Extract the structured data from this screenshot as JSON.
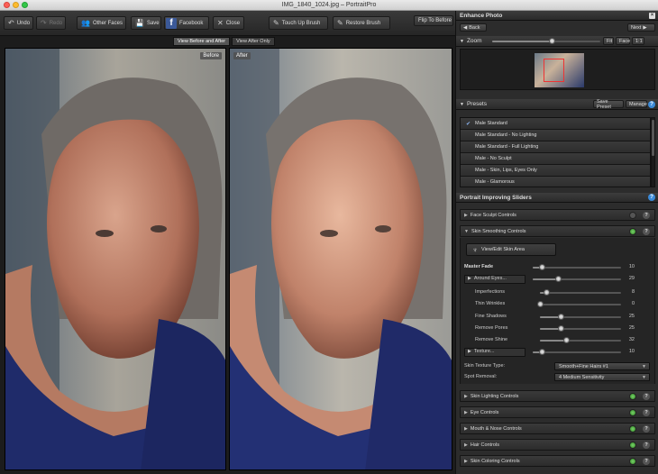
{
  "window": {
    "title": "IMG_1840_1024.jpg – PortraitPro"
  },
  "toolbar": {
    "undo": "Undo",
    "redo": "Redo",
    "other_faces": "Other Faces",
    "save": "Save",
    "facebook": "Facebook",
    "close": "Close",
    "touch_up_brush": "Touch Up Brush",
    "restore_brush": "Restore Brush",
    "flip_to_before": "Flip To Before"
  },
  "view_tabs": {
    "before_after": "View Before and After",
    "after_only": "View After Only"
  },
  "photos": {
    "before_label": "Before",
    "after_label": "After"
  },
  "enhance": {
    "title": "Enhance Photo",
    "back": "Back",
    "next": "Next",
    "zoom_label": "Zoom",
    "zoom_level": 0.55,
    "fit": "Fit",
    "face": "Face",
    "one_to_one": "1:1"
  },
  "presets": {
    "title": "Presets",
    "save_preset": "Save Preset",
    "manage": "Manage",
    "items": [
      "Male Standard",
      "Male Standard - No Lighting",
      "Male Standard - Full Lighting",
      "Male - No Sculpt",
      "Male - Skin, Lips, Eyes Only",
      "Male - Glamorous"
    ]
  },
  "sliders": {
    "title": "Portrait Improving Sliders",
    "face_sculpt": "Face Sculpt Controls",
    "skin_smoothing": "Skin Smoothing Controls",
    "view_edit_skin": "View/Edit Skin Area",
    "master_fade": {
      "label": "Master Fade",
      "value": "10"
    },
    "around_eyes": {
      "label": "Around Eyes...",
      "value": "29"
    },
    "imperfections": {
      "label": "Imperfections",
      "value": "8"
    },
    "thin_wrinkles": {
      "label": "Thin Wrinkles",
      "value": "0"
    },
    "fine_shadows": {
      "label": "Fine Shadows",
      "value": "25"
    },
    "remove_pores": {
      "label": "Remove Pores",
      "value": "25"
    },
    "remove_shine": {
      "label": "Remove Shine",
      "value": "32"
    },
    "texture": {
      "label": "Texture...",
      "value": "10"
    },
    "skin_texture_type": {
      "label": "Skin Texture Type:",
      "value": "Smooth+Fine Hairs #1"
    },
    "spot_removal": {
      "label": "Spot Removal:",
      "value": "4 Medium Sensitivity"
    },
    "groups": [
      "Skin Lighting Controls",
      "Eye Controls",
      "Mouth & Nose Controls",
      "Hair Controls",
      "Skin Coloring Controls"
    ]
  },
  "colors": {
    "accent": "#3b8ad8",
    "active_dot": "#3fa832",
    "facebook": "#3b5998"
  }
}
